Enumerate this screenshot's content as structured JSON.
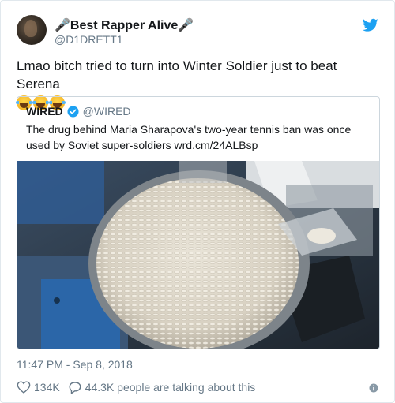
{
  "author": {
    "display_name_prefix": "🎤",
    "display_name": "Best Rapper Alive",
    "display_name_suffix": "🎤",
    "handle": "@D1DRETT1"
  },
  "tweet": {
    "text": "Lmao bitch tried to turn into Winter Soldier just to beat Serena",
    "emoji": [
      "face-with-tears-of-joy",
      "face-with-tears-of-joy",
      "face-with-tears-of-joy"
    ]
  },
  "quoted": {
    "name": "WIRED",
    "handle": "@WIRED",
    "text": "The drug behind Maria Sharapova's two-year tennis ban was once used by Soviet super-soldiers wrd.cm/24ALBsp",
    "image_subject": "bowl of white pills on production machine"
  },
  "footer": {
    "timestamp": "11:47 PM - Sep 8, 2018",
    "likes": "134K",
    "replies_text": "44.3K people are talking about this"
  },
  "icons": {
    "brand": "twitter-bird-icon",
    "verified": "verified-badge-icon",
    "like": "heart-icon",
    "reply": "speech-bubble-icon",
    "info": "info-icon"
  },
  "colors": {
    "brand_blue": "#1da1f2",
    "text_primary": "#14171a",
    "text_secondary": "#657786",
    "border": "#e1e8ed"
  }
}
